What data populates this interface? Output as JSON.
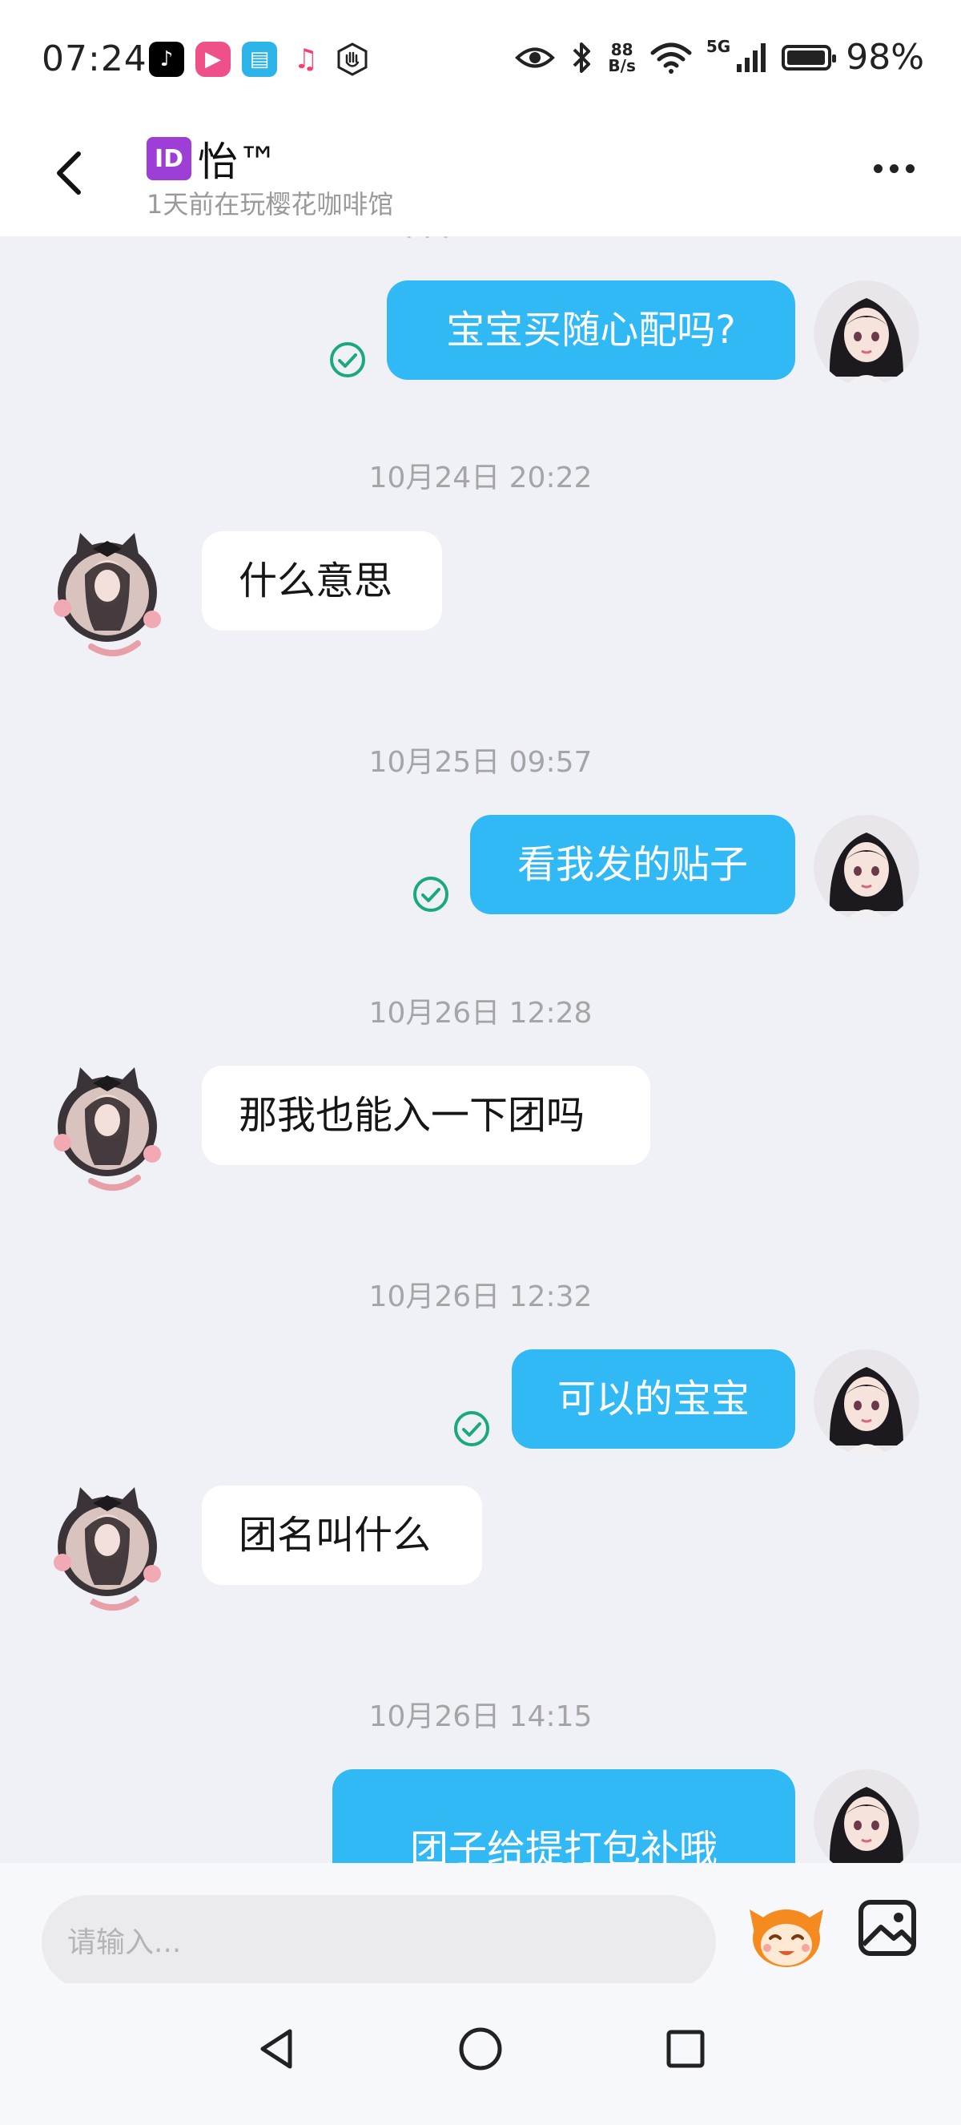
{
  "status_bar": {
    "time": "07:24",
    "net_speed_value": "88",
    "net_speed_unit": "B/s",
    "network_type": "5G",
    "battery_percent": "98%",
    "battery_level": 0.98,
    "app_icons": [
      "tiktok-icon",
      "video-icon",
      "book-icon",
      "music-icon",
      "hexagon-hand-icon"
    ],
    "system_icons": [
      "eye-icon",
      "bluetooth-icon",
      "wifi-icon",
      "signal-icon",
      "battery-icon"
    ]
  },
  "header": {
    "badge": "ID",
    "name": "怡™",
    "subtitle": "1天前在玩樱花咖啡馆"
  },
  "chat": {
    "messages": [
      {
        "side": "out",
        "text": "宝宝买随心配吗?"
      },
      {
        "side": "time",
        "text": "10月24日 20:22"
      },
      {
        "side": "in",
        "text": "什么意思"
      },
      {
        "side": "time",
        "text": "10月25日 09:57"
      },
      {
        "side": "out",
        "text": "看我发的贴子"
      },
      {
        "side": "time",
        "text": "10月26日 12:28"
      },
      {
        "side": "in",
        "text": "那我也能入一下团吗"
      },
      {
        "side": "time",
        "text": "10月26日 12:32"
      },
      {
        "side": "out",
        "text": "可以的宝宝"
      },
      {
        "side": "in",
        "text": "团名叫什么"
      },
      {
        "side": "time",
        "text": "10月26日 14:15"
      },
      {
        "side": "out",
        "text": "团子给提打包补哦"
      }
    ]
  },
  "input": {
    "placeholder": "请输入..."
  },
  "colors": {
    "outgoing_bubble": "#31b9f6",
    "incoming_bubble": "#ffffff",
    "chat_background": "#f0f1f7",
    "read_check": "#1aa97a",
    "id_badge": "#9d3fd6"
  }
}
